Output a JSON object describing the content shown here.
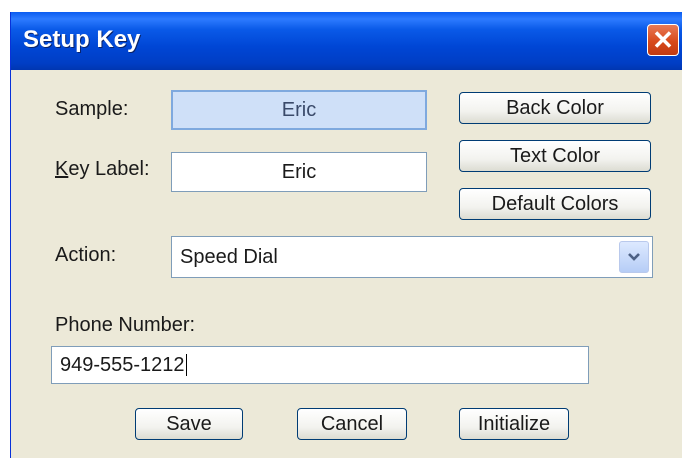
{
  "window": {
    "title": "Setup Key",
    "close_glyph": "✕"
  },
  "form": {
    "sample_label": "Sample:",
    "sample_value": "Eric",
    "key_label_mnemonic": "K",
    "key_label_rest": "ey Label:",
    "key_label_value": "Eric",
    "action_label": "Action:",
    "action_value": "Speed Dial",
    "phone_label": "Phone Number:",
    "phone_value": "949-555-1212"
  },
  "buttons": {
    "back_color": "Back Color",
    "text_color": "Text Color",
    "default_colors": "Default Colors",
    "save": "Save",
    "cancel": "Cancel",
    "initialize": "Initialize"
  },
  "colors": {
    "title_bar": "#0046d5",
    "dialog_bg": "#ece9d8",
    "sample_bg": "#cfe0f8",
    "close_button": "#d84a1c"
  },
  "icons": {
    "close": "close-icon",
    "dropdown": "chevron-down-icon"
  }
}
